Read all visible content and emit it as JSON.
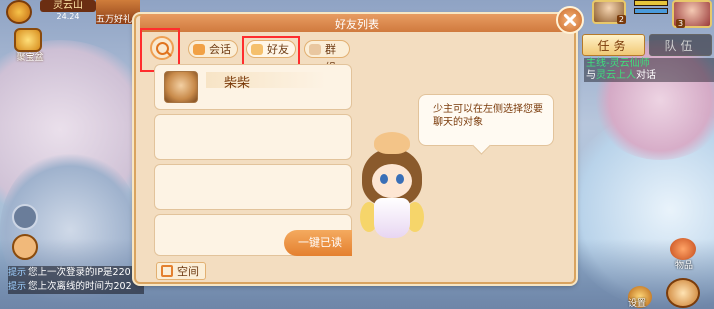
{
  "hud": {
    "map_name": "灵云山",
    "map_time": "24.24",
    "top_label": "五万好礼",
    "treasure_label": "聚宝盆",
    "player_level_small": "2",
    "player_level_big": "3"
  },
  "quest": {
    "tab_task": "任务",
    "tab_team": "队伍",
    "line1": "主线-灵云仙师",
    "line2_pre": "与",
    "line2_npc": "灵云上人",
    "line2_post": "对话"
  },
  "dialog": {
    "title": "好友列表",
    "tab_chat": "会话",
    "tab_friends": "好友",
    "tab_group": "群组",
    "friends": [
      {
        "name": "柴柴"
      }
    ],
    "read_all": "一键已读",
    "space": "空间",
    "tip": "少主可以在左侧选择您要聊天的对象"
  },
  "system_messages": [
    {
      "tag": "提示",
      "text": "您上一次登录的IP是220"
    },
    {
      "tag": "提示",
      "text": "您上次离线的时间为202"
    }
  ],
  "bottom_right": {
    "bag": "物品",
    "settings": "设置"
  }
}
